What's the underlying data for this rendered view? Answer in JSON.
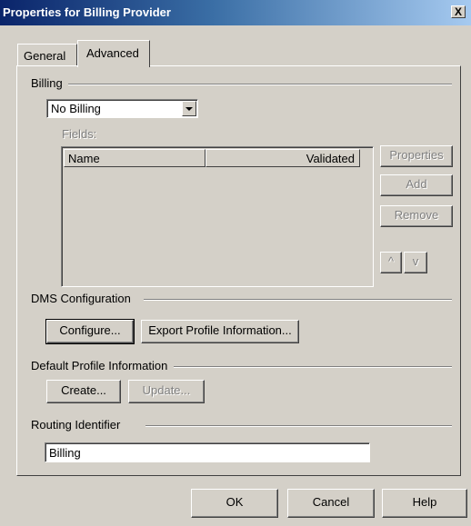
{
  "window": {
    "title": "Properties for Billing Provider",
    "close_label": "X"
  },
  "tabs": [
    {
      "label": "General",
      "active": false
    },
    {
      "label": "Advanced",
      "active": true
    }
  ],
  "billing": {
    "group_label": "Billing",
    "selected": "No Billing",
    "fields_label": "Fields:",
    "columns": [
      "Name",
      "Validated"
    ],
    "rows": [],
    "buttons": {
      "properties": "Properties",
      "add": "Add",
      "remove": "Remove",
      "up": "^",
      "down": "v"
    }
  },
  "dms": {
    "group_label": "DMS Configuration",
    "configure": "Configure...",
    "export": "Export Profile Information..."
  },
  "profile": {
    "group_label": "Default Profile Information",
    "create": "Create...",
    "update": "Update..."
  },
  "routing": {
    "group_label": "Routing Identifier",
    "value": "Billing"
  },
  "footer": {
    "ok": "OK",
    "cancel": "Cancel",
    "help": "Help"
  }
}
